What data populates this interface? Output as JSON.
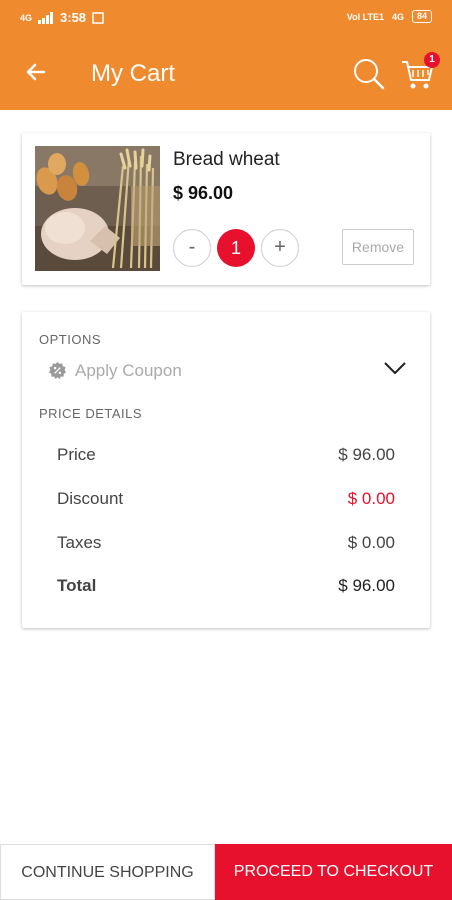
{
  "status_bar": {
    "network_left": "4G",
    "time": "3:58",
    "volte": "Vol LTE1",
    "network_right": "4G",
    "battery": "84"
  },
  "header": {
    "title": "My Cart",
    "cart_count": "1",
    "background_color": "#ef8a2e"
  },
  "cart_item": {
    "name": "Bread wheat",
    "price": "$ 96.00",
    "quantity": "1",
    "minus_label": "-",
    "plus_label": "+",
    "remove_label": "Remove"
  },
  "options": {
    "section_label": "OPTIONS",
    "coupon_label": "Apply Coupon"
  },
  "price_details": {
    "section_label": "PRICE DETAILS",
    "rows": [
      {
        "label": "Price",
        "value": "$ 96.00"
      },
      {
        "label": "Discount",
        "value": "$ 0.00"
      },
      {
        "label": "Taxes",
        "value": "$ 0.00"
      },
      {
        "label": "Total",
        "value": "$ 96.00"
      }
    ]
  },
  "footer": {
    "continue_label": "CONTINUE SHOPPING",
    "checkout_label": "PROCEED TO CHECKOUT"
  },
  "colors": {
    "accent_orange": "#ef8a2e",
    "accent_red": "#e8112d"
  }
}
